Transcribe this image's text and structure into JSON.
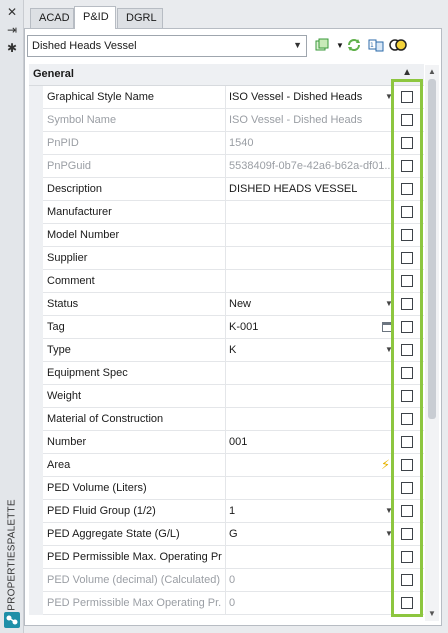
{
  "strip": {
    "close_icon": "✕",
    "pin_icon": "⇥",
    "settings_icon": "✱",
    "palette_label": "PROPERTIESPALETTE"
  },
  "tabs": [
    {
      "label": "ACAD",
      "active": false
    },
    {
      "label": "P&ID",
      "active": true
    },
    {
      "label": "DGRL",
      "active": false
    }
  ],
  "toolbar": {
    "selection": "Dished Heads Vessel",
    "icons": [
      "select-objects-icon",
      "dropdown-icon",
      "refresh-icon",
      "toggle-pickadd-icon",
      "quick-select-icon"
    ]
  },
  "group": {
    "title": "General"
  },
  "properties": [
    {
      "name": "Graphical Style Name",
      "value": "ISO Vessel - Dished Heads",
      "control": "dropdown",
      "disabled": false
    },
    {
      "name": "Symbol Name",
      "value": "ISO Vessel - Dished Heads",
      "control": "",
      "disabled": true
    },
    {
      "name": "PnPID",
      "value": "1540",
      "control": "",
      "disabled": true
    },
    {
      "name": "PnPGuid",
      "value": "5538409f-0b7e-42a6-b62a-df01...",
      "control": "",
      "disabled": true
    },
    {
      "name": "Description",
      "value": "DISHED HEADS VESSEL",
      "control": "",
      "disabled": false
    },
    {
      "name": "Manufacturer",
      "value": "",
      "control": "",
      "disabled": false
    },
    {
      "name": "Model Number",
      "value": "",
      "control": "",
      "disabled": false
    },
    {
      "name": "Supplier",
      "value": "",
      "control": "",
      "disabled": false
    },
    {
      "name": "Comment",
      "value": "",
      "control": "",
      "disabled": false
    },
    {
      "name": "Status",
      "value": "New",
      "control": "dropdown",
      "disabled": false
    },
    {
      "name": "Tag",
      "value": "K-001",
      "control": "picker",
      "disabled": false
    },
    {
      "name": "Type",
      "value": "K",
      "control": "dropdown",
      "disabled": false
    },
    {
      "name": "Equipment Spec",
      "value": "",
      "control": "",
      "disabled": false
    },
    {
      "name": "Weight",
      "value": "",
      "control": "",
      "disabled": false
    },
    {
      "name": "Material of Construction",
      "value": "",
      "control": "",
      "disabled": false
    },
    {
      "name": "Number",
      "value": "001",
      "control": "",
      "disabled": false
    },
    {
      "name": "Area",
      "value": "",
      "control": "bolt",
      "disabled": false
    },
    {
      "name": "PED Volume (Liters)",
      "value": "",
      "control": "",
      "disabled": false
    },
    {
      "name": "PED Fluid Group (1/2)",
      "value": "1",
      "control": "dropdown",
      "disabled": false
    },
    {
      "name": "PED Aggregate State (G/L)",
      "value": "G",
      "control": "dropdown",
      "disabled": false
    },
    {
      "name": "PED Permissible Max. Operating Pr...",
      "value": "",
      "control": "",
      "disabled": false
    },
    {
      "name": "PED Volume (decimal) (Calculated)",
      "value": "0",
      "control": "",
      "disabled": true
    },
    {
      "name": "PED Permissible Max Operating Pr...",
      "value": "0",
      "control": "",
      "disabled": true
    }
  ],
  "colors": {
    "highlight": "#8dc63f",
    "panel_bg": "#ffffff",
    "group_bg": "#eef0f3"
  }
}
